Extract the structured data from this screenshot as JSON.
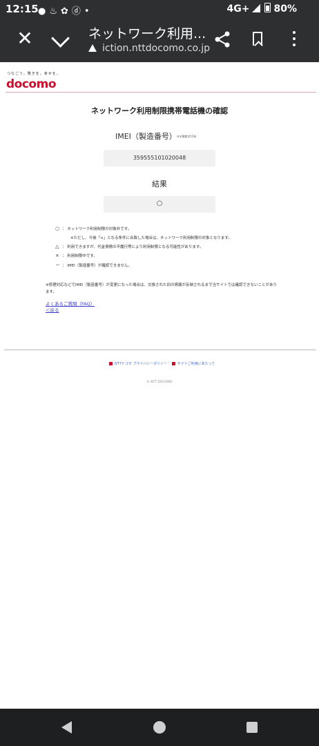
{
  "status_bar": {
    "time": "12:15",
    "network": "4G+",
    "battery": "80%"
  },
  "browser": {
    "title": "ネットワーク利用...",
    "url": "iction.nttdocomo.co.jp"
  },
  "brand": {
    "tagline": "つなごう。驚きを。幸せを。",
    "logo": "docomo"
  },
  "main": {
    "title": "ネットワーク利用制限携帯電話機の確認",
    "imei_label": "IMEI（製造番号）",
    "imei_note": "※半角数字15桁",
    "imei_value": "359555101020048",
    "result_label": "結果",
    "result_value": "○"
  },
  "legend": [
    {
      "symbol": "○",
      "text": "：  ネットワーク利用制限の対象外です。"
    },
    {
      "symbol": "",
      "text": "※ただし、今後「×」となる条件に合致した場合は、ネットワーク利用制限の対象となります。"
    },
    {
      "symbol": "△",
      "text": "：  利用できますが、代金債務の不履行等により利用制限となる可能性があります。"
    },
    {
      "symbol": "×",
      "text": "：  利用制限中です。"
    },
    {
      "symbol": "－",
      "text": "：  IMEI（製造番号）が確認できません。"
    }
  ],
  "note": "※修理対応などでIMEI（製造番号）が変更になった場合は、交換された旧の情報が反映されるまで当サイトでは確認できないことがあります。",
  "links": {
    "faq": "よくあるご質問（FAQ）",
    "back": "＜戻る"
  },
  "footer": {
    "privacy": "NTTドコモ プライバシーポリシー",
    "about_site": "サイトご利用にあたって",
    "copyright": "© NTT DOCOMO"
  },
  "colors": {
    "brand_red": "#c8102e",
    "toolbar": "#2d2f30",
    "link": "#3a3ad0"
  }
}
